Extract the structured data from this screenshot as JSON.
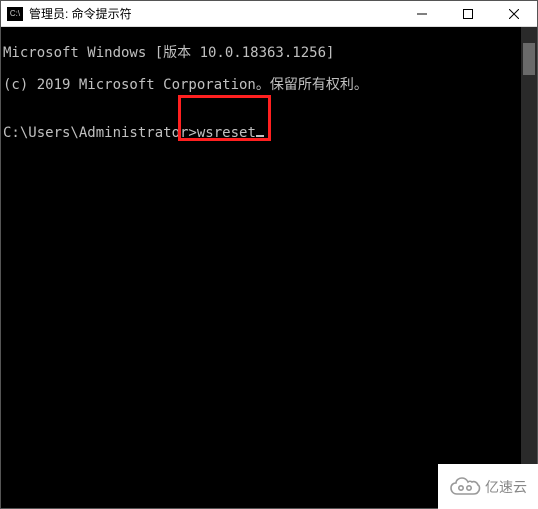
{
  "titlebar": {
    "icon_label": "C:\\",
    "title": "管理员: 命令提示符"
  },
  "console": {
    "line1": "Microsoft Windows [版本 10.0.18363.1256]",
    "line2": "(c) 2019 Microsoft Corporation。保留所有权利。",
    "prompt": "C:\\Users\\Administrator>",
    "command": "wsreset"
  },
  "watermark": {
    "text": "亿速云"
  }
}
